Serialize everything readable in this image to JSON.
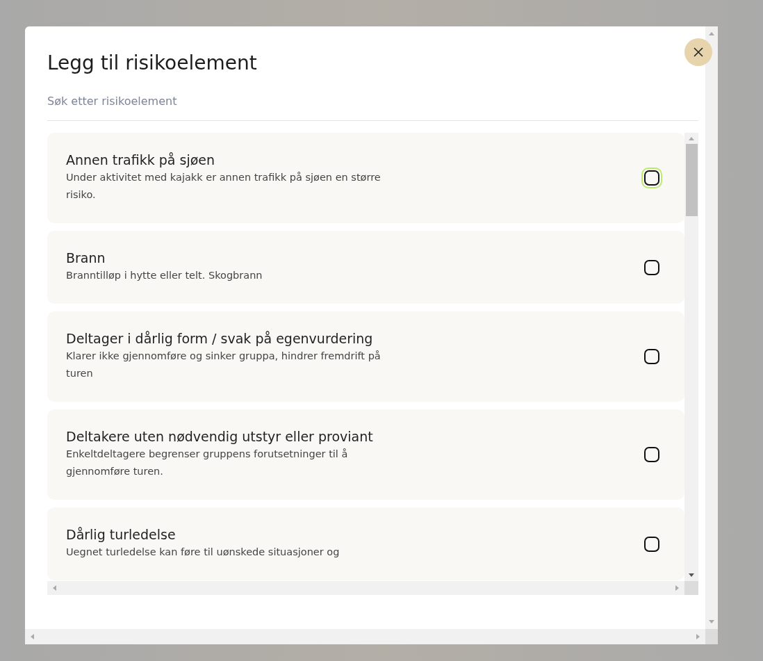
{
  "dialog": {
    "title": "Legg til risikoelement",
    "search": {
      "placeholder": "Søk etter risikoelement"
    }
  },
  "items": [
    {
      "title": "Annen trafikk på sjøen",
      "description": "Under aktivitet med kajakk er annen trafikk på sjøen en større risiko.",
      "checked": false,
      "focused": true
    },
    {
      "title": "Brann",
      "description": "Branntilløp i hytte eller telt. Skogbrann",
      "checked": false,
      "focused": false
    },
    {
      "title": "Deltager i dårlig form / svak på egenvurdering",
      "description": "Klarer ikke gjennomføre og sinker gruppa, hindrer fremdrift på turen",
      "checked": false,
      "focused": false
    },
    {
      "title": "Deltakere uten nødvendig utstyr eller proviant",
      "description": "Enkeltdeltagere begrenser gruppens forutsetninger til å gjennomføre turen.",
      "checked": false,
      "focused": false
    },
    {
      "title": "Dårlig turledelse",
      "description": "Uegnet turledelse kan føre til uønskede situasjoner og",
      "checked": false,
      "focused": false
    }
  ]
}
